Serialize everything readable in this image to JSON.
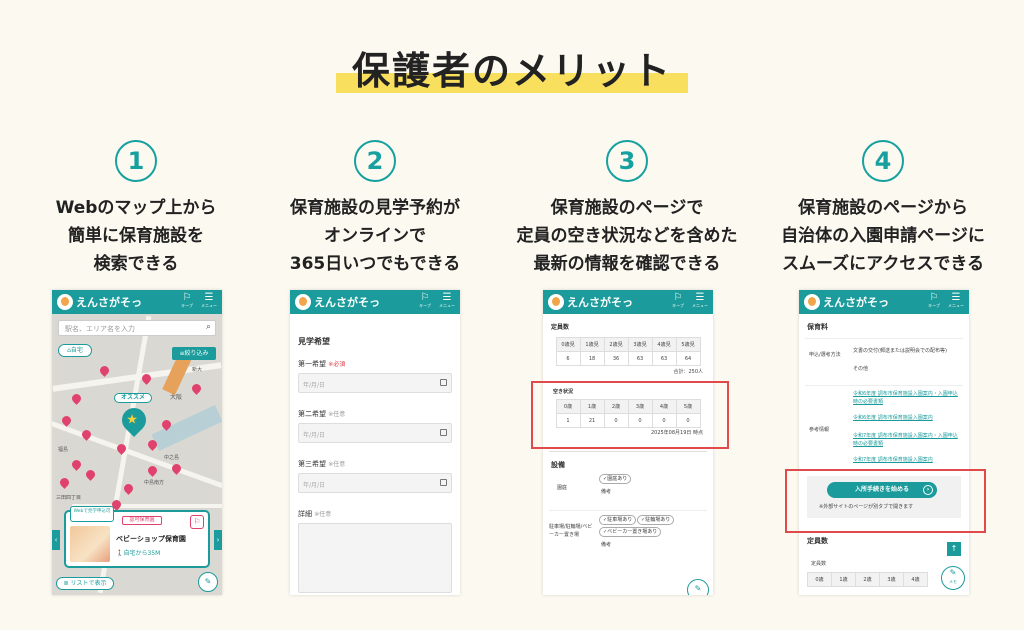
{
  "title": "保護者のメリット",
  "features": [
    {
      "num": "1",
      "lines": [
        "Webのマップ上から",
        "簡単に保育施設を",
        "検索できる"
      ]
    },
    {
      "num": "2",
      "lines": [
        "保育施設の見学予約が",
        "オンラインで",
        "365日いつでもできる"
      ]
    },
    {
      "num": "3",
      "lines": [
        "保育施設のページで",
        "定員の空き状況などを含めた",
        "最新の情報を確認できる"
      ]
    },
    {
      "num": "4",
      "lines": [
        "保育施設のページから",
        "自治体の入園申請ページに",
        "スムーズにアクセスできる"
      ]
    }
  ],
  "app": {
    "brand": "えんさがそっ",
    "keep": "キープ",
    "menu": "メニュー"
  },
  "screen1": {
    "search_placeholder": "駅名、エリア名を入力",
    "home_btn": "自宅",
    "filter_btn": "絞り込み",
    "recommend": "オススメ",
    "map_labels": [
      "三田四丁目",
      "中島南方",
      "新大",
      "大阪",
      "中之島",
      "福島"
    ],
    "card_badge_web": "Webで見学申込可",
    "card_badge_cert": "認可保育園",
    "card_name": "ベビーショップ保育園",
    "card_dist": "自宅から35M",
    "list_btn": "リストで表示"
  },
  "screen2": {
    "section": "見学希望",
    "fields": [
      {
        "label": "第一希望",
        "tag": "※必須",
        "required": true,
        "placeholder": "年/月/日"
      },
      {
        "label": "第二希望",
        "tag": "※任意",
        "required": false,
        "placeholder": "年/月/日"
      },
      {
        "label": "第三希望",
        "tag": "※任意",
        "required": false,
        "placeholder": "年/月/日"
      }
    ],
    "detail_label": "詳細",
    "detail_tag": "※任意"
  },
  "screen3": {
    "capacity_title": "定員数",
    "capacity_head": [
      "0歳児",
      "1歳児",
      "2歳児",
      "3歳児",
      "4歳児",
      "5歳児"
    ],
    "capacity_vals": [
      "6",
      "18",
      "36",
      "63",
      "63",
      "64"
    ],
    "capacity_total": "合計：250人",
    "vacancy_title": "空き状況",
    "vacancy_head": [
      "0歳",
      "1歳",
      "2歳",
      "3歳",
      "4歳",
      "5歳"
    ],
    "vacancy_vals": [
      "1",
      "21",
      "0",
      "0",
      "0",
      "0"
    ],
    "vacancy_date": "2025年08月19日 時点",
    "equip_title": "設備",
    "rows": [
      {
        "label": "園庭",
        "tags": [
          "園庭あり"
        ],
        "note": "備考"
      },
      {
        "label": "駐車場/駐輪場/ベビーカー置き場",
        "tags": [
          "駐車場あり",
          "駐輪場あり",
          "ベビーカー置き場あり"
        ],
        "note": "備考"
      }
    ]
  },
  "screen4": {
    "fee_title": "保育料",
    "apply_label": "申込/選考方法",
    "apply_text": [
      "文書の交付(郵送または説明会での配布等)",
      "その他"
    ],
    "ref_label": "参考情報",
    "links": [
      "令和6年度 調布市保育施設入園案内・入園申込時の必要書類",
      "令和6年度 調布市保育施設入園案内",
      "令和7年度 調布市保育施設入園案内・入園申込時の必要書類",
      "令和7年度 調布市保育施設入園案内"
    ],
    "apply_btn": "入所手続きを始める",
    "apply_note": "※外部サイトのページが別タブで開きます",
    "capacity_title": "定員数",
    "capacity_sub": "定員数",
    "capacity_head": [
      "0歳",
      "1歳",
      "2歳",
      "3歳",
      "4歳"
    ],
    "memo": "メモ"
  },
  "colors": {
    "teal": "#1b9b9b",
    "yellow": "#f9df5e",
    "red": "#e04a4a",
    "pin": "#e0416d"
  }
}
